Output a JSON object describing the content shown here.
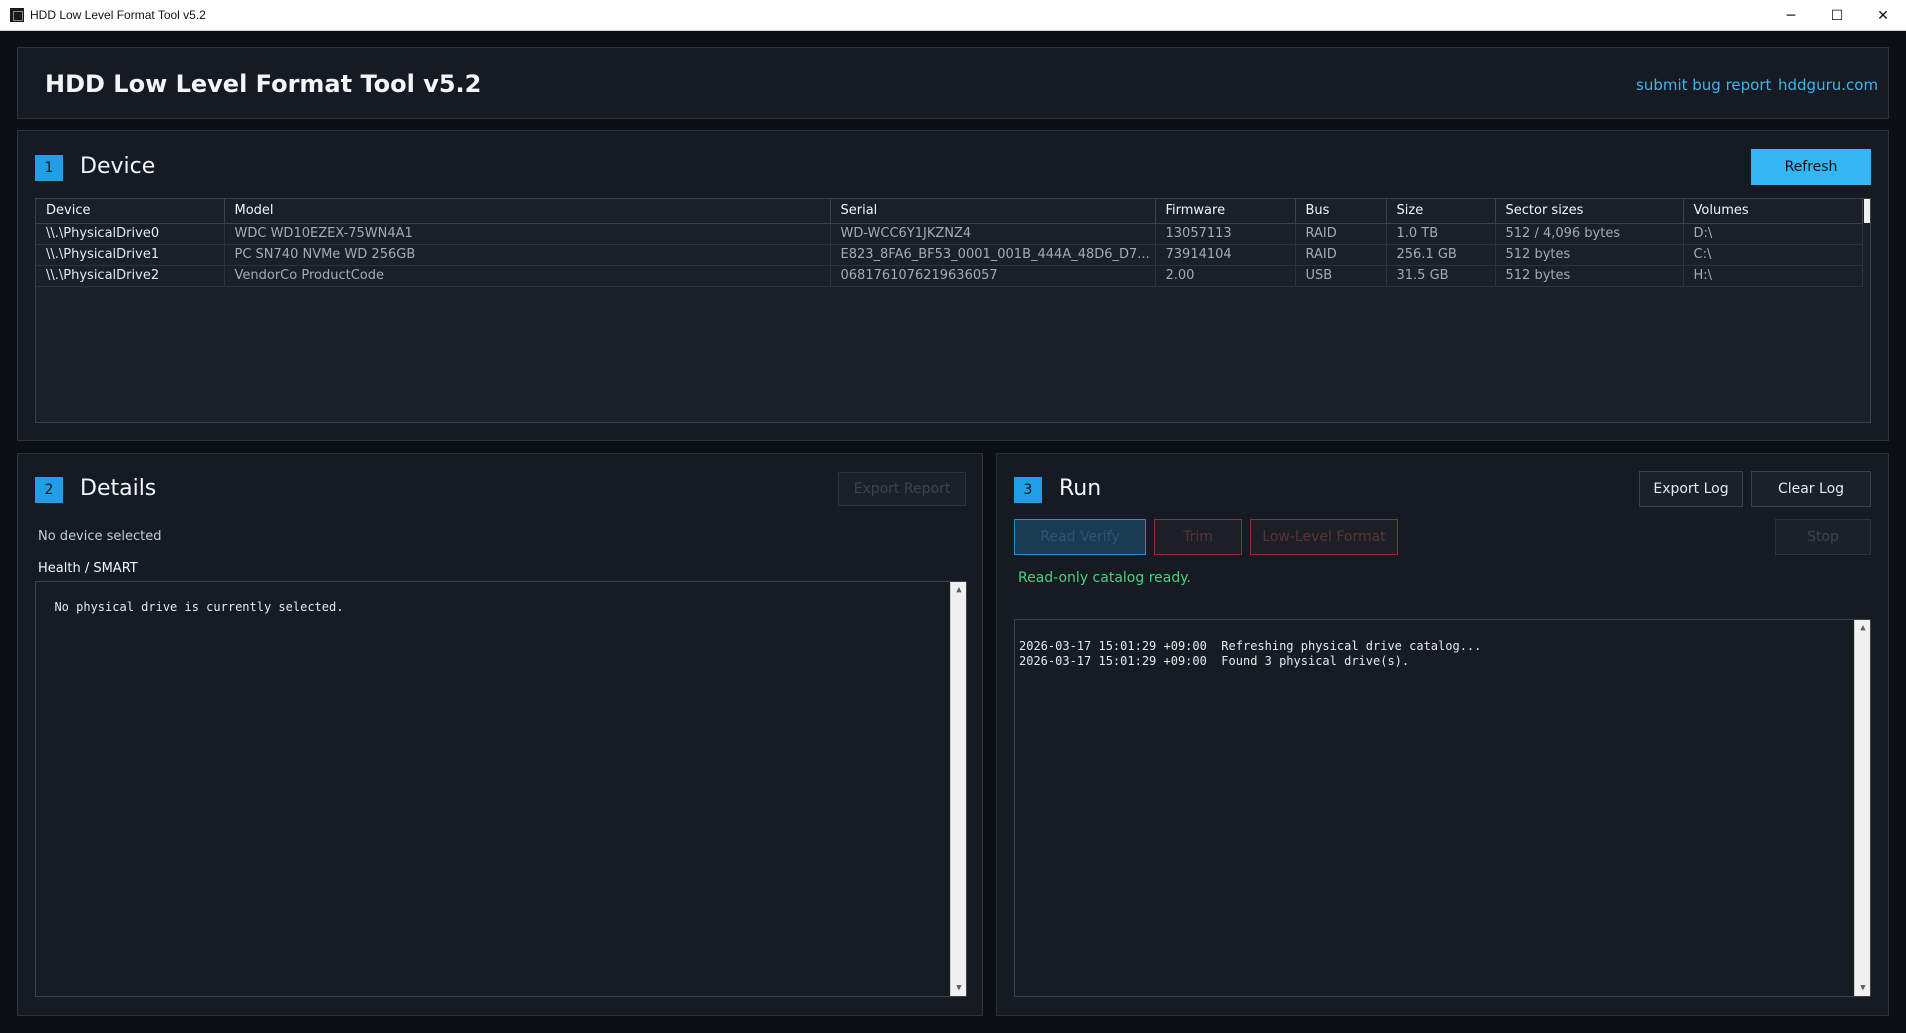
{
  "window": {
    "title": "HDD Low Level Format Tool v5.2",
    "controls": {
      "minimize": "─",
      "maximize": "☐",
      "close": "✕"
    }
  },
  "header": {
    "title": "HDD Low Level Format Tool v5.2",
    "links": {
      "bug_report": "submit bug report",
      "site": "hddguru.com"
    }
  },
  "device_section": {
    "number": "1",
    "title": "Device",
    "refresh_label": "Refresh",
    "columns": [
      "Device",
      "Model",
      "Serial",
      "Firmware",
      "Bus",
      "Size",
      "Sector sizes",
      "Volumes"
    ],
    "rows": [
      [
        "\\\\.\\PhysicalDrive0",
        "WDC WD10EZEX-75WN4A1",
        "WD-WCC6Y1JKZNZ4",
        "13057113",
        "RAID",
        "1.0 TB",
        "512 / 4,096 bytes",
        "D:\\"
      ],
      [
        "\\\\.\\PhysicalDrive1",
        "PC SN740 NVMe WD 256GB",
        "E823_8FA6_BF53_0001_001B_444A_48D6_D7...",
        "73914104",
        "RAID",
        "256.1 GB",
        "512 bytes",
        "C:\\"
      ],
      [
        "\\\\.\\PhysicalDrive2",
        "VendorCo ProductCode",
        "0681761076219636057",
        "2.00",
        "USB",
        "31.5 GB",
        "512 bytes",
        "H:\\"
      ]
    ]
  },
  "details_section": {
    "number": "2",
    "title": "Details",
    "export_report_label": "Export Report",
    "selection_status": "No device selected",
    "health_label": "Health / SMART",
    "health_text": "No physical drive is currently selected."
  },
  "run_section": {
    "number": "3",
    "title": "Run",
    "export_log_label": "Export Log",
    "clear_log_label": "Clear Log",
    "read_verify_label": "Read Verify",
    "trim_label": "Trim",
    "llf_label": "Low-Level Format",
    "stop_label": "Stop",
    "status_text": "Read-only catalog ready.",
    "status_color": "#4cd07a",
    "log_lines": [
      "2026-03-17 15:01:29 +09:00  Refreshing physical drive catalog...",
      "2026-03-17 15:01:29 +09:00  Found 3 physical drive(s)."
    ]
  },
  "colors": {
    "accent": "#33b7f2",
    "link": "#3cb4f0",
    "danger": "#9b2a30"
  }
}
